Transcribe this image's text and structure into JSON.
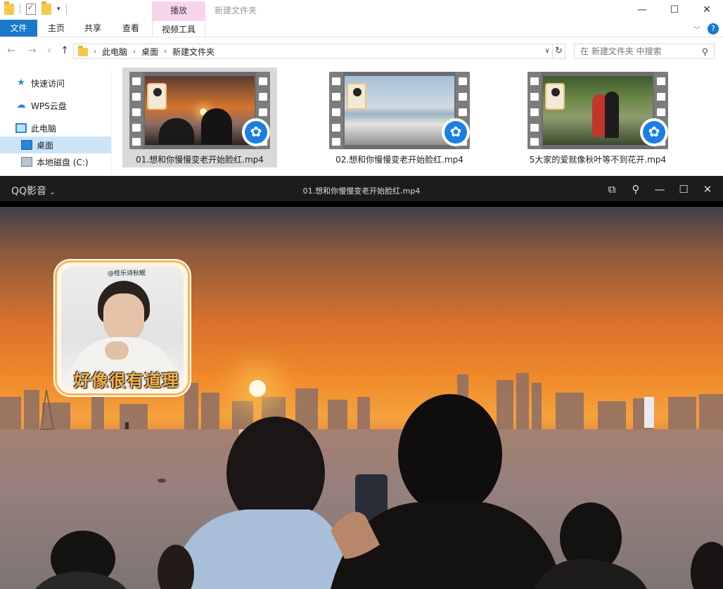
{
  "explorer": {
    "title": "新建文件夹",
    "context_tab_header": "播放",
    "ribbon_tabs": [
      "文件",
      "主页",
      "共享",
      "查看",
      "视频工具"
    ],
    "breadcrumb": [
      "此电脑",
      "桌面",
      "新建文件夹"
    ],
    "search_placeholder": "在 新建文件夹 中搜索",
    "nav_items": [
      "快速访问",
      "WPS云盘",
      "此电脑",
      "桌面",
      "本地磁盘 (C:)"
    ],
    "files": [
      {
        "name": "01.想和你慢慢变老开始脸红.mp4"
      },
      {
        "name": "02.想和你慢慢变老开始脸红.mp4"
      },
      {
        "name": "5大家的爱就像秋叶等不到花开.mp4"
      }
    ]
  },
  "player": {
    "brand": "QQ影音",
    "title": "01.想和你慢慢变老开始脸红.mp4",
    "overlay_watermark": "@桂乐诗秋眠",
    "overlay_caption": "好像很有道理"
  },
  "colors": {
    "accent": "#1979ca",
    "context_tab": "#f7d5ea",
    "player_bg": "#1c1c1c"
  }
}
